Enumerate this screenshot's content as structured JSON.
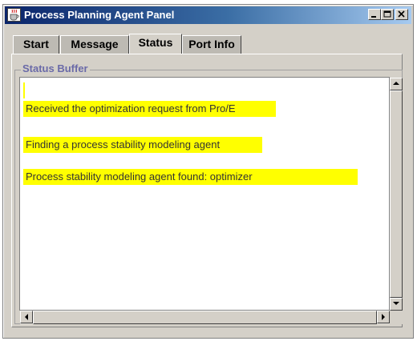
{
  "window": {
    "title": "Process Planning Agent Panel",
    "app_icon": "java-cup-icon",
    "controls": [
      "minimize-icon",
      "maximize-icon",
      "close-icon"
    ]
  },
  "tabs": [
    {
      "label": "Start",
      "selected": false
    },
    {
      "label": "Message",
      "selected": false
    },
    {
      "label": "Status",
      "selected": true
    },
    {
      "label": "Port Info",
      "selected": false
    }
  ],
  "status_buffer": {
    "title": "Status Buffer",
    "lines": [
      "",
      "Received the optimization request from Pro/E",
      "Finding a process stability modeling agent",
      "Process stability modeling agent found: optimizer"
    ],
    "highlight_color": "#ffff00"
  },
  "colors": {
    "window_bg": "#d4d0c8",
    "titlebar_start": "#0a246a",
    "titlebar_end": "#a6caf0",
    "group_title": "#6a6aa8"
  }
}
